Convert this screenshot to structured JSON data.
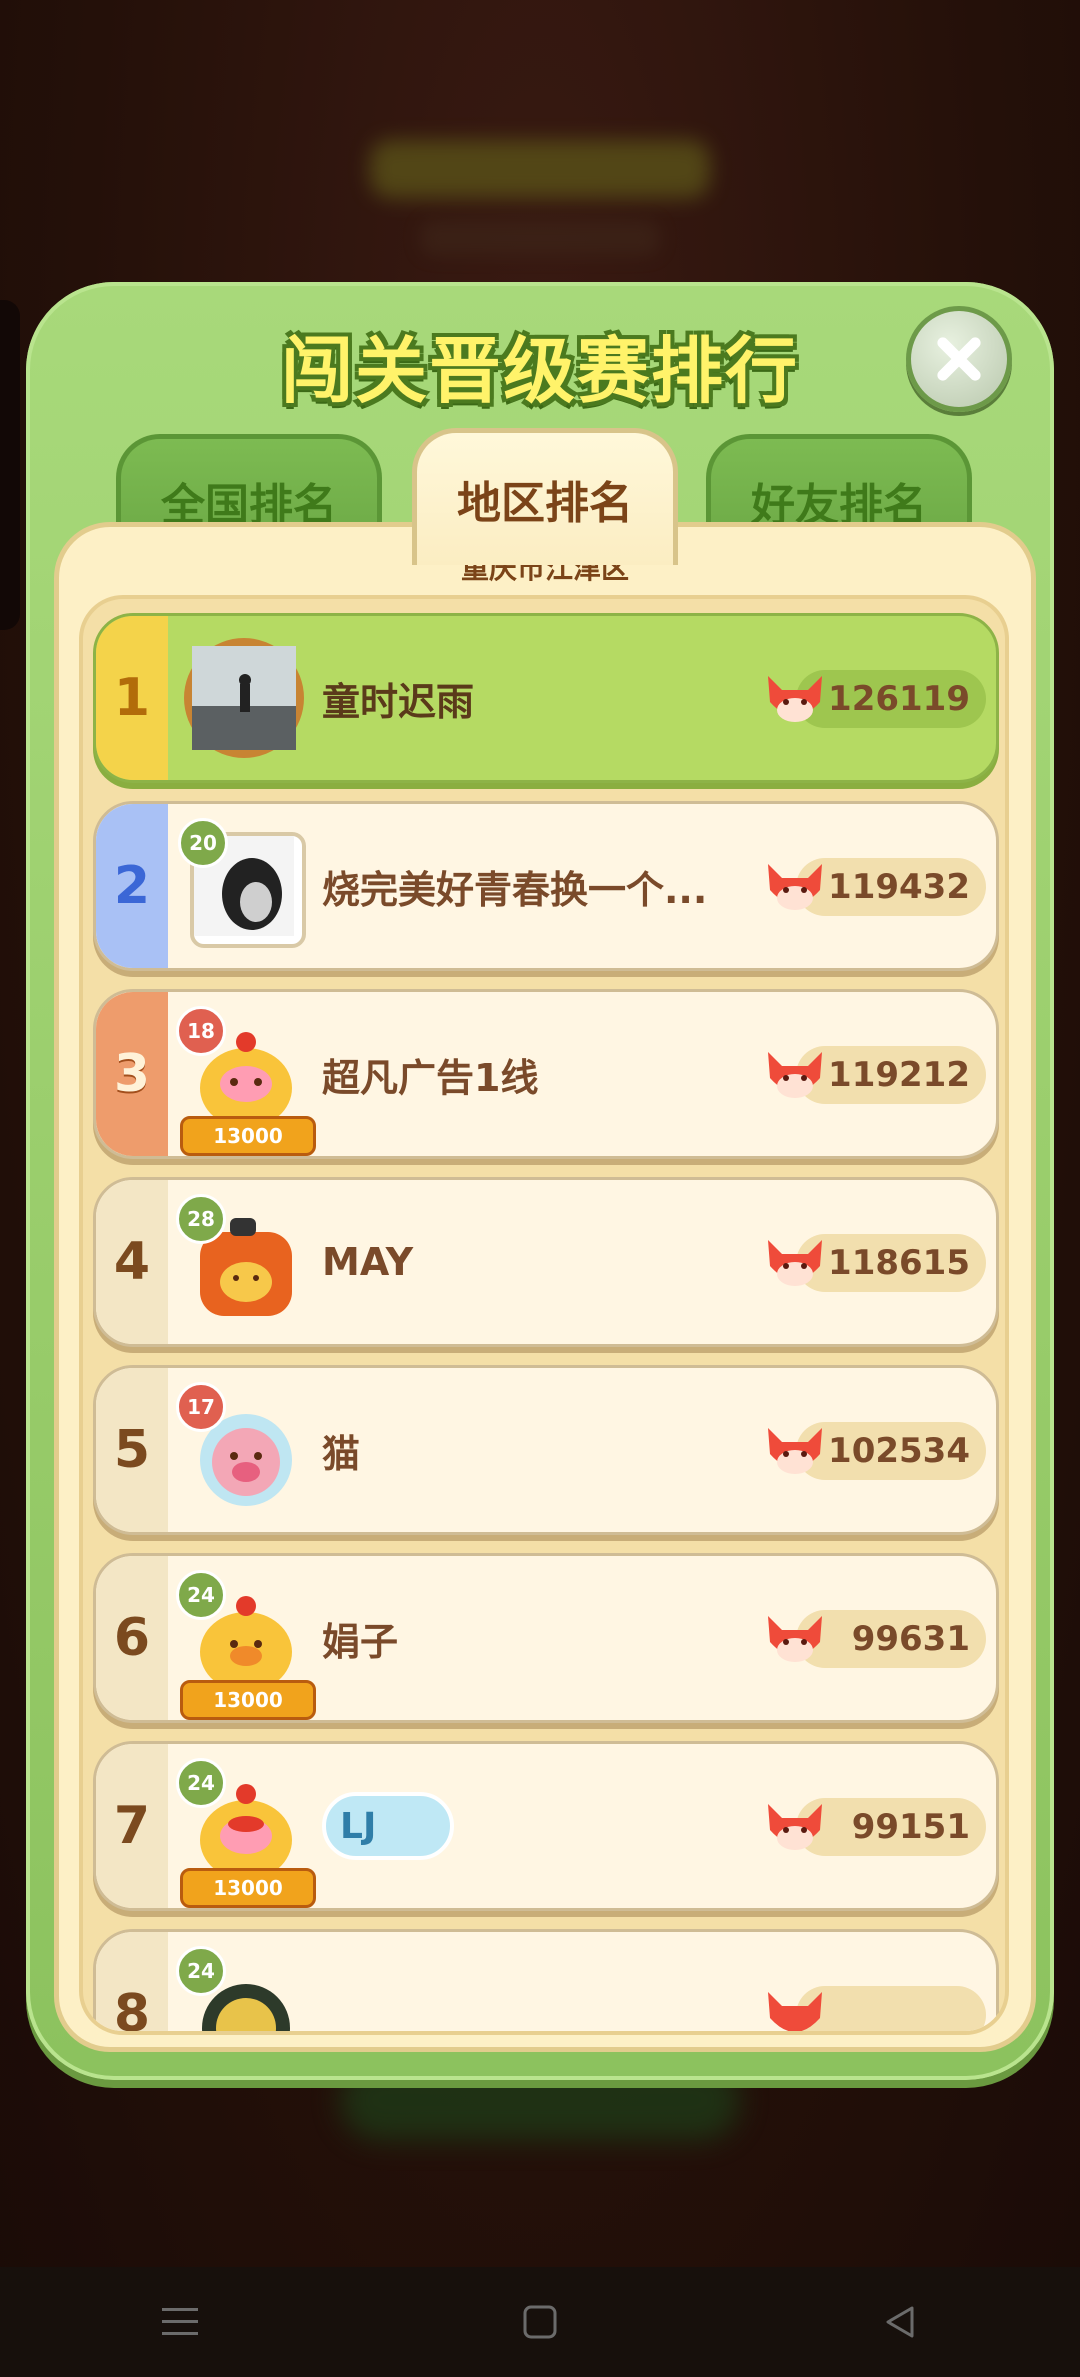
{
  "modal": {
    "title": "闯关晋级赛排行",
    "tabs": [
      {
        "label": "全国排名",
        "active": false
      },
      {
        "label": "地区排名",
        "active": true
      },
      {
        "label": "好友排名",
        "active": false
      }
    ],
    "region": "重庆市江津区"
  },
  "ranking": [
    {
      "rank": "1",
      "name": "童时迟雨",
      "score": "126119",
      "level": ""
    },
    {
      "rank": "2",
      "name": "烧完美好青春换一个...",
      "score": "119432",
      "level": "20"
    },
    {
      "rank": "3",
      "name": "超凡广告1线",
      "score": "119212",
      "level": "18",
      "frame_label": "13000"
    },
    {
      "rank": "4",
      "name": "MAY",
      "score": "118615",
      "level": "28"
    },
    {
      "rank": "5",
      "name": "猫",
      "score": "102534",
      "level": "17"
    },
    {
      "rank": "6",
      "name": "娟子",
      "score": "99631",
      "level": "24",
      "frame_label": "13000"
    },
    {
      "rank": "7",
      "name": "LJ",
      "score": "99151",
      "level": "24",
      "frame_label": "13000"
    },
    {
      "rank": "8",
      "name": "",
      "score": "",
      "level": "24"
    }
  ],
  "icons": {
    "close": "close-icon",
    "score": "fox-icon",
    "nav": [
      "menu-icon",
      "home-icon",
      "back-icon"
    ]
  },
  "colors": {
    "modal_green": "#a8d97a",
    "title_yellow": "#fff36a",
    "first_row": "#b5da63",
    "panel_cream": "#fdf0c6"
  }
}
